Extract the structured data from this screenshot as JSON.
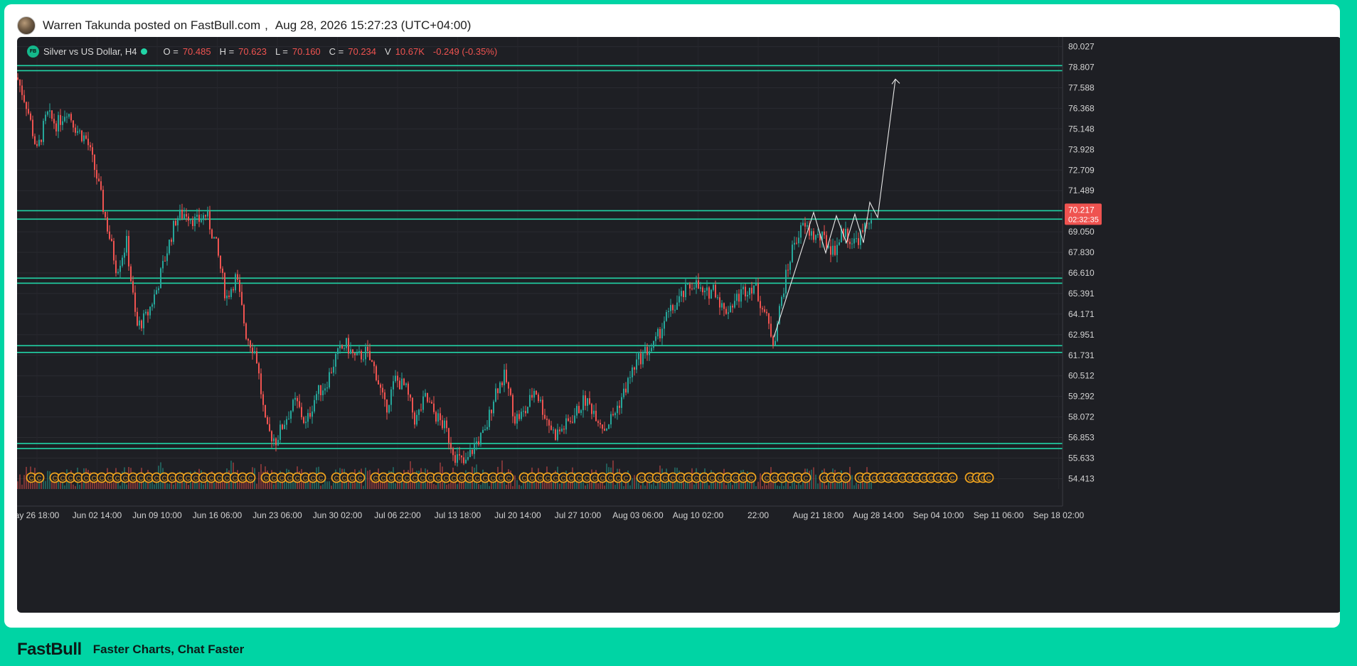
{
  "post": {
    "author_line": "Warren Takunda posted on FastBull.com",
    "separator": ",",
    "timestamp": "Aug 28, 2026 15:27:23 (UTC+04:00)"
  },
  "legend": {
    "symbol": "Silver vs US Dollar, H4",
    "logo_text": "FB",
    "o_label": "O =",
    "o_value": "70.485",
    "h_label": "H =",
    "h_value": "70.623",
    "l_label": "L =",
    "l_value": "70.160",
    "c_label": "C =",
    "c_value": "70.234",
    "v_label": "V",
    "v_value": "10.67K",
    "change": "-0.249 (-0.35%)"
  },
  "footer": {
    "brand": "FastBull",
    "tagline": "Faster Charts, Chat Faster"
  },
  "colors": {
    "up": "#26a69a",
    "down": "#ef5350",
    "level": "#21d4a6",
    "background": "#1e1f24",
    "accent": "#00d4a4",
    "event_marker": "#f0a31e"
  },
  "chart_data": {
    "type": "candlestick",
    "title": "Silver vs US Dollar, H4",
    "ylim": [
      53.8,
      80.6
    ],
    "y_ticks": [
      "80.027",
      "78.807",
      "77.588",
      "76.368",
      "75.148",
      "73.928",
      "72.709",
      "71.489",
      "69.050",
      "67.830",
      "66.610",
      "65.391",
      "64.171",
      "62.951",
      "61.731",
      "60.512",
      "59.292",
      "58.072",
      "56.853",
      "55.633",
      "54.413"
    ],
    "y_tick_values": [
      80.027,
      78.807,
      77.588,
      76.368,
      75.148,
      73.928,
      72.709,
      71.489,
      69.05,
      67.83,
      66.61,
      65.391,
      64.171,
      62.951,
      61.731,
      60.512,
      59.292,
      58.072,
      56.853,
      55.633,
      54.413
    ],
    "x_ticks": [
      "ay 26 18:00",
      "Jun 02 14:00",
      "Jun 09 10:00",
      "Jun 16 06:00",
      "Jun 23 06:00",
      "Jun 30 02:00",
      "Jul 06 22:00",
      "Jul 13 18:00",
      "Jul 20 14:00",
      "Jul 27 10:00",
      "Aug 03 06:00",
      "Aug 10 02:00",
      "22:00",
      "Aug 21 18:00",
      "Aug 28 14:00",
      "Sep 04 10:00",
      "Sep 11 06:00",
      "Sep 18 02:00"
    ],
    "last_price": "70.217",
    "countdown": "02:32:35",
    "last_price_value": 70.217,
    "horizontal_levels": [
      {
        "top": 78.9,
        "bottom": 78.6
      },
      {
        "top": 70.3,
        "bottom": 69.8
      },
      {
        "top": 66.3,
        "bottom": 66.0
      },
      {
        "top": 62.3,
        "bottom": 61.9
      },
      {
        "top": 56.5,
        "bottom": 56.2
      }
    ],
    "close_path": [
      [
        0,
        78.2
      ],
      [
        14,
        76.5
      ],
      [
        28,
        73.8
      ],
      [
        42,
        76.0
      ],
      [
        56,
        75.4
      ],
      [
        70,
        76.3
      ],
      [
        84,
        75.1
      ],
      [
        98,
        74.5
      ],
      [
        112,
        72.3
      ],
      [
        126,
        69.5
      ],
      [
        140,
        66.8
      ],
      [
        154,
        68.4
      ],
      [
        168,
        63.4
      ],
      [
        182,
        64.0
      ],
      [
        196,
        65.6
      ],
      [
        210,
        67.8
      ],
      [
        224,
        69.9
      ],
      [
        238,
        70.2
      ],
      [
        252,
        69.6
      ],
      [
        266,
        70.1
      ],
      [
        280,
        68.2
      ],
      [
        294,
        65.1
      ],
      [
        308,
        66.4
      ],
      [
        322,
        63.0
      ],
      [
        336,
        61.8
      ],
      [
        350,
        57.3
      ],
      [
        364,
        56.7
      ],
      [
        378,
        58.0
      ],
      [
        392,
        59.0
      ],
      [
        406,
        57.6
      ],
      [
        420,
        59.4
      ],
      [
        434,
        60.0
      ],
      [
        448,
        61.6
      ],
      [
        462,
        62.4
      ],
      [
        476,
        61.5
      ],
      [
        490,
        61.9
      ],
      [
        504,
        60.8
      ],
      [
        518,
        58.5
      ],
      [
        532,
        60.3
      ],
      [
        546,
        59.8
      ],
      [
        560,
        57.8
      ],
      [
        574,
        59.2
      ],
      [
        588,
        58.2
      ],
      [
        602,
        57.4
      ],
      [
        616,
        55.8
      ],
      [
        630,
        55.2
      ],
      [
        644,
        56.5
      ],
      [
        658,
        57.1
      ],
      [
        672,
        59.6
      ],
      [
        686,
        60.5
      ],
      [
        700,
        58.0
      ],
      [
        714,
        58.3
      ],
      [
        728,
        59.8
      ],
      [
        742,
        58.2
      ],
      [
        756,
        57.0
      ],
      [
        770,
        57.5
      ],
      [
        784,
        58.2
      ],
      [
        798,
        59.1
      ],
      [
        812,
        58.4
      ],
      [
        826,
        57.4
      ],
      [
        840,
        58.3
      ],
      [
        854,
        59.6
      ],
      [
        868,
        61.1
      ],
      [
        882,
        61.9
      ],
      [
        896,
        62.3
      ],
      [
        910,
        63.8
      ],
      [
        924,
        64.6
      ],
      [
        938,
        65.4
      ],
      [
        952,
        66.1
      ],
      [
        966,
        65.2
      ],
      [
        980,
        65.8
      ],
      [
        994,
        64.3
      ],
      [
        1008,
        64.9
      ],
      [
        1022,
        65.6
      ],
      [
        1036,
        65.9
      ],
      [
        1050,
        64.4
      ],
      [
        1064,
        62.5
      ],
      [
        1078,
        65.8
      ],
      [
        1092,
        68.4
      ],
      [
        1106,
        69.4
      ],
      [
        1120,
        68.8
      ],
      [
        1134,
        68.6
      ],
      [
        1148,
        67.9
      ],
      [
        1162,
        69.1
      ],
      [
        1176,
        68.4
      ],
      [
        1190,
        69.0
      ],
      [
        1202,
        70.2
      ]
    ],
    "projection_path": [
      [
        1064,
        62.8
      ],
      [
        1120,
        70.2
      ],
      [
        1137,
        67.8
      ],
      [
        1152,
        70.0
      ],
      [
        1166,
        68.4
      ],
      [
        1178,
        70.1
      ],
      [
        1190,
        68.4
      ],
      [
        1199,
        70.8
      ],
      [
        1210,
        69.9
      ],
      [
        1235,
        78.1
      ]
    ],
    "volume_range": [
      0,
      1
    ],
    "event_marker_label": "C"
  }
}
